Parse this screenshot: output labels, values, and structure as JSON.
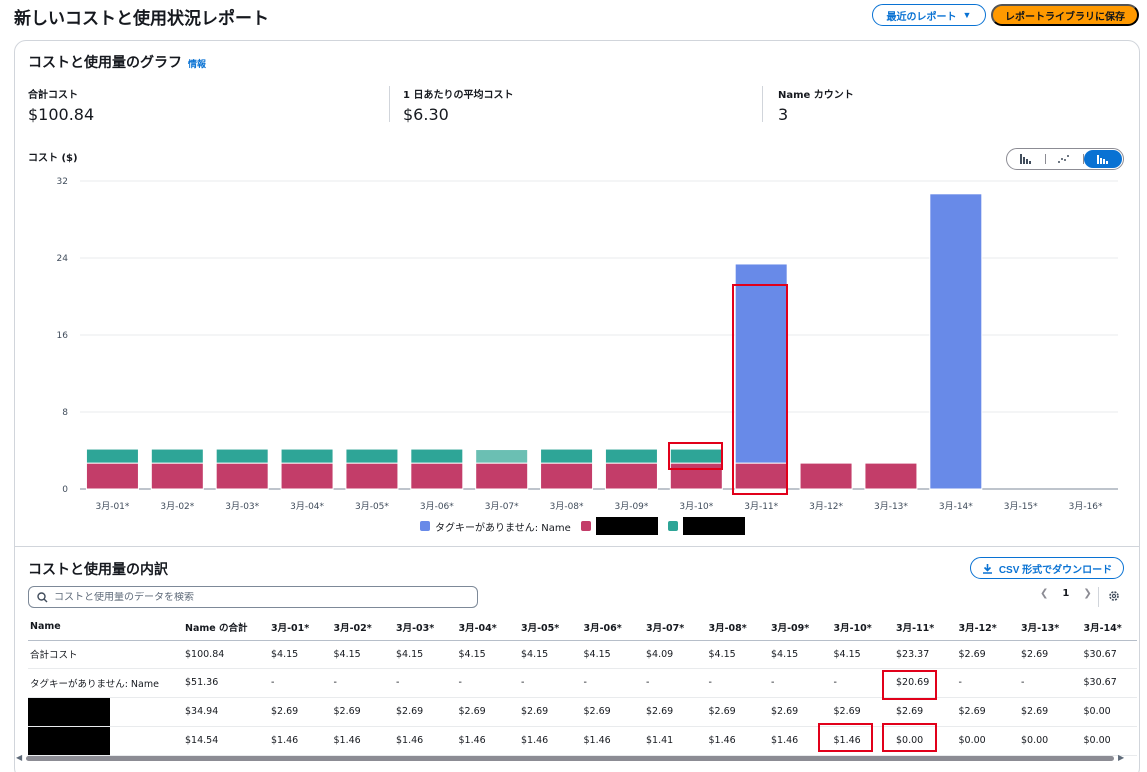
{
  "header": {
    "title": "新しいコストと使用状況レポート",
    "recent_button": "最近のレポート",
    "save_button": "レポートライブラリに保存"
  },
  "graph": {
    "title": "コストと使用量のグラフ",
    "info": "情報",
    "metrics": [
      {
        "label": "合計コスト",
        "value": "$100.84"
      },
      {
        "label": "1 日あたりの平均コスト",
        "value": "$6.30"
      },
      {
        "label": "Name カウント",
        "value": "3"
      }
    ],
    "y_axis_title": "コスト ($)",
    "view_options": [
      "bar-chart-icon",
      "line-chart-icon",
      "stacked-bar-chart-icon"
    ],
    "colors": {
      "untagged": "#688ae8",
      "series2": "#c33d69",
      "series3": "#2ea597",
      "series3_alt": "#6bbfb3"
    }
  },
  "chart_data": {
    "type": "bar",
    "stacked": true,
    "categories": [
      "3月-01*",
      "3月-02*",
      "3月-03*",
      "3月-04*",
      "3月-05*",
      "3月-06*",
      "3月-07*",
      "3月-08*",
      "3月-09*",
      "3月-10*",
      "3月-11*",
      "3月-12*",
      "3月-13*",
      "3月-14*",
      "3月-15*",
      "3月-16*"
    ],
    "series": [
      {
        "name": "",
        "values": [
          2.69,
          2.69,
          2.69,
          2.69,
          2.69,
          2.69,
          2.69,
          2.69,
          2.69,
          2.69,
          2.69,
          2.69,
          2.69,
          0,
          0,
          0
        ]
      },
      {
        "name": "",
        "values": [
          1.46,
          1.46,
          1.46,
          1.46,
          1.46,
          1.46,
          1.41,
          1.46,
          1.46,
          1.46,
          0,
          0,
          0,
          0,
          0,
          0
        ]
      },
      {
        "name": "タグキーがありません: Name",
        "values": [
          0,
          0,
          0,
          0,
          0,
          0,
          0,
          0,
          0,
          0,
          20.69,
          0,
          0,
          30.67,
          0,
          0
        ]
      }
    ],
    "yticks": [
      0,
      8,
      16,
      24,
      32
    ],
    "ylim": [
      0,
      32
    ],
    "grid": true,
    "legend": "bottom-center",
    "legend_entries": [
      "タグキーがありません: Name"
    ]
  },
  "breakdown": {
    "title": "コストと使用量の内訳",
    "csv_button": "CSV 形式でダウンロード",
    "search_placeholder": "コストと使用量のデータを検索",
    "page": "1",
    "columns": [
      "Name",
      "Name の合計",
      "3月-01*",
      "3月-02*",
      "3月-03*",
      "3月-04*",
      "3月-05*",
      "3月-06*",
      "3月-07*",
      "3月-08*",
      "3月-09*",
      "3月-10*",
      "3月-11*",
      "3月-12*",
      "3月-13*",
      "3月-14*"
    ],
    "rows": [
      {
        "name": "合計コスト",
        "cells": [
          "$100.84",
          "$4.15",
          "$4.15",
          "$4.15",
          "$4.15",
          "$4.15",
          "$4.15",
          "$4.09",
          "$4.15",
          "$4.15",
          "$4.15",
          "$23.37",
          "$2.69",
          "$2.69",
          "$30.67"
        ]
      },
      {
        "name": "タグキーがありません: Name",
        "cells": [
          "$51.36",
          "-",
          "-",
          "-",
          "-",
          "-",
          "-",
          "-",
          "-",
          "-",
          "-",
          "$20.69",
          "-",
          "-",
          "$30.67"
        ]
      },
      {
        "name": "",
        "cells": [
          "$34.94",
          "$2.69",
          "$2.69",
          "$2.69",
          "$2.69",
          "$2.69",
          "$2.69",
          "$2.69",
          "$2.69",
          "$2.69",
          "$2.69",
          "$2.69",
          "$2.69",
          "$2.69",
          "$0.00"
        ]
      },
      {
        "name": "",
        "cells": [
          "$14.54",
          "$1.46",
          "$1.46",
          "$1.46",
          "$1.46",
          "$1.46",
          "$1.46",
          "$1.41",
          "$1.46",
          "$1.46",
          "$1.46",
          "$0.00",
          "$0.00",
          "$0.00",
          "$0.00"
        ]
      }
    ]
  }
}
